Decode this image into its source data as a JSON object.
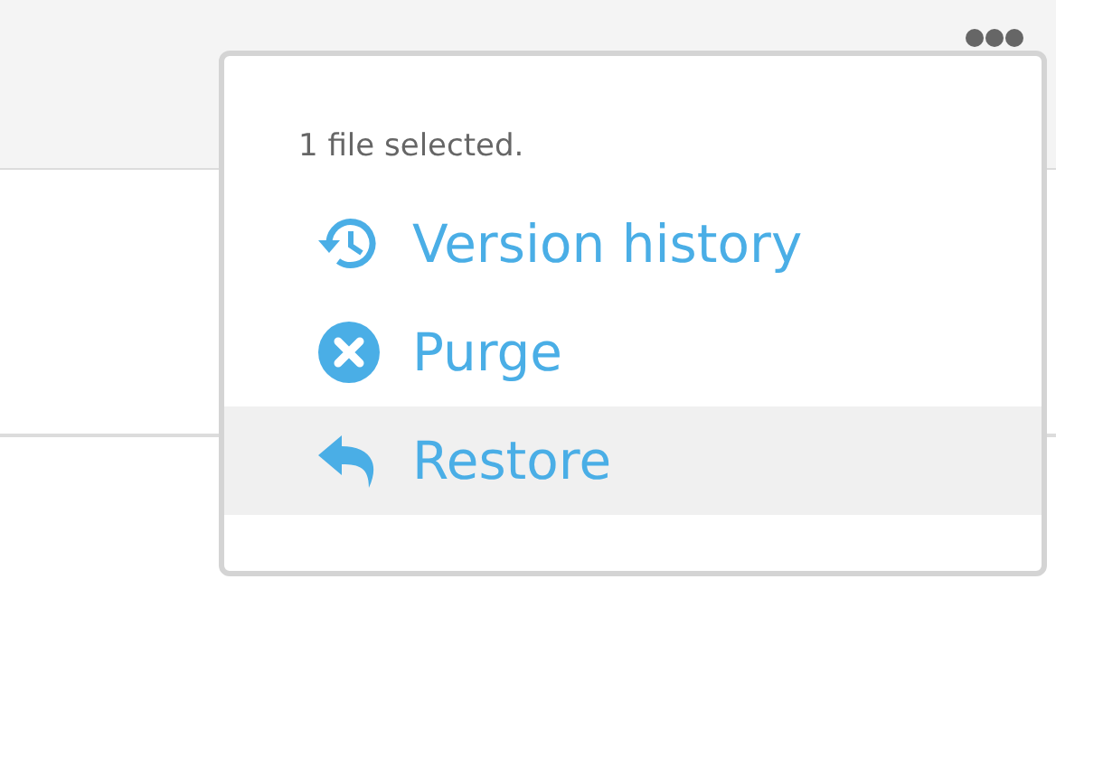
{
  "menu": {
    "heading": "1 file selected.",
    "items": [
      {
        "kind": "history",
        "label": "Version history",
        "selected": false
      },
      {
        "kind": "purge",
        "label": "Purge",
        "selected": false
      },
      {
        "kind": "restore",
        "label": "Restore",
        "selected": true
      }
    ]
  }
}
